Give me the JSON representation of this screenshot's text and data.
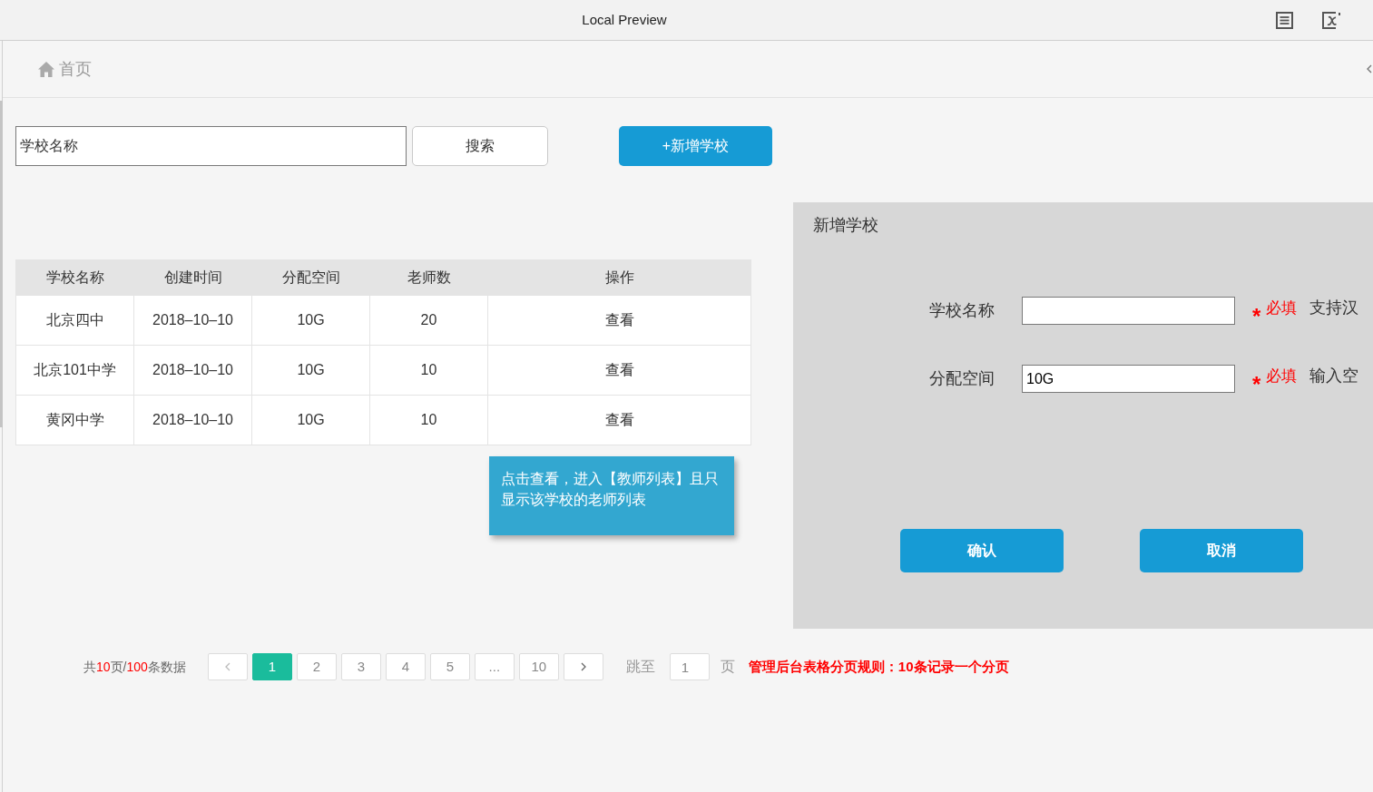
{
  "window": {
    "title": "Local Preview"
  },
  "breadcrumb": {
    "label": "首页"
  },
  "search": {
    "value": "学校名称",
    "button": "搜索"
  },
  "add_button": "+新增学校",
  "table": {
    "columns": [
      "学校名称",
      "创建时间",
      "分配空间",
      "老师数",
      "操作"
    ],
    "rows": [
      {
        "name": "北京四中",
        "created": "2018–10–10",
        "space": "10G",
        "teachers": "20",
        "action": "查看"
      },
      {
        "name": "北京101中学",
        "created": "2018–10–10",
        "space": "10G",
        "teachers": "10",
        "action": "查看"
      },
      {
        "name": "黄冈中学",
        "created": "2018–10–10",
        "space": "10G",
        "teachers": "10",
        "action": "查看"
      }
    ]
  },
  "note": "点击查看，进入【教师列表】且只显示该学校的老师列表",
  "pagination": {
    "summary": [
      {
        "text": "共",
        "highlight": false
      },
      {
        "text": "10",
        "highlight": true
      },
      {
        "text": "页/",
        "highlight": false
      },
      {
        "text": "100",
        "highlight": true
      },
      {
        "text": "条数据",
        "highlight": false
      }
    ],
    "pages": [
      {
        "label": "1",
        "selected": true
      },
      {
        "label": "2",
        "selected": false
      },
      {
        "label": "3",
        "selected": false
      },
      {
        "label": "4",
        "selected": false
      },
      {
        "label": "5",
        "selected": false
      },
      {
        "label": "...",
        "selected": false
      },
      {
        "label": "10",
        "selected": false
      }
    ],
    "jump_label": "跳至",
    "jump_value": "1",
    "page_unit": "页"
  },
  "rule_note": "管理后台表格分页规则：10条记录一个分页",
  "dialog": {
    "title": "新增学校",
    "fields": [
      {
        "label": "学校名称",
        "required_mark": "*",
        "required": "必填",
        "hint": "支持汉"
      },
      {
        "label": "分配空间",
        "value": "10G",
        "required_mark": "*",
        "required": "必填",
        "hint": "输入空"
      }
    ],
    "buttons": [
      {
        "label": "确认"
      },
      {
        "label": "取消"
      }
    ]
  }
}
